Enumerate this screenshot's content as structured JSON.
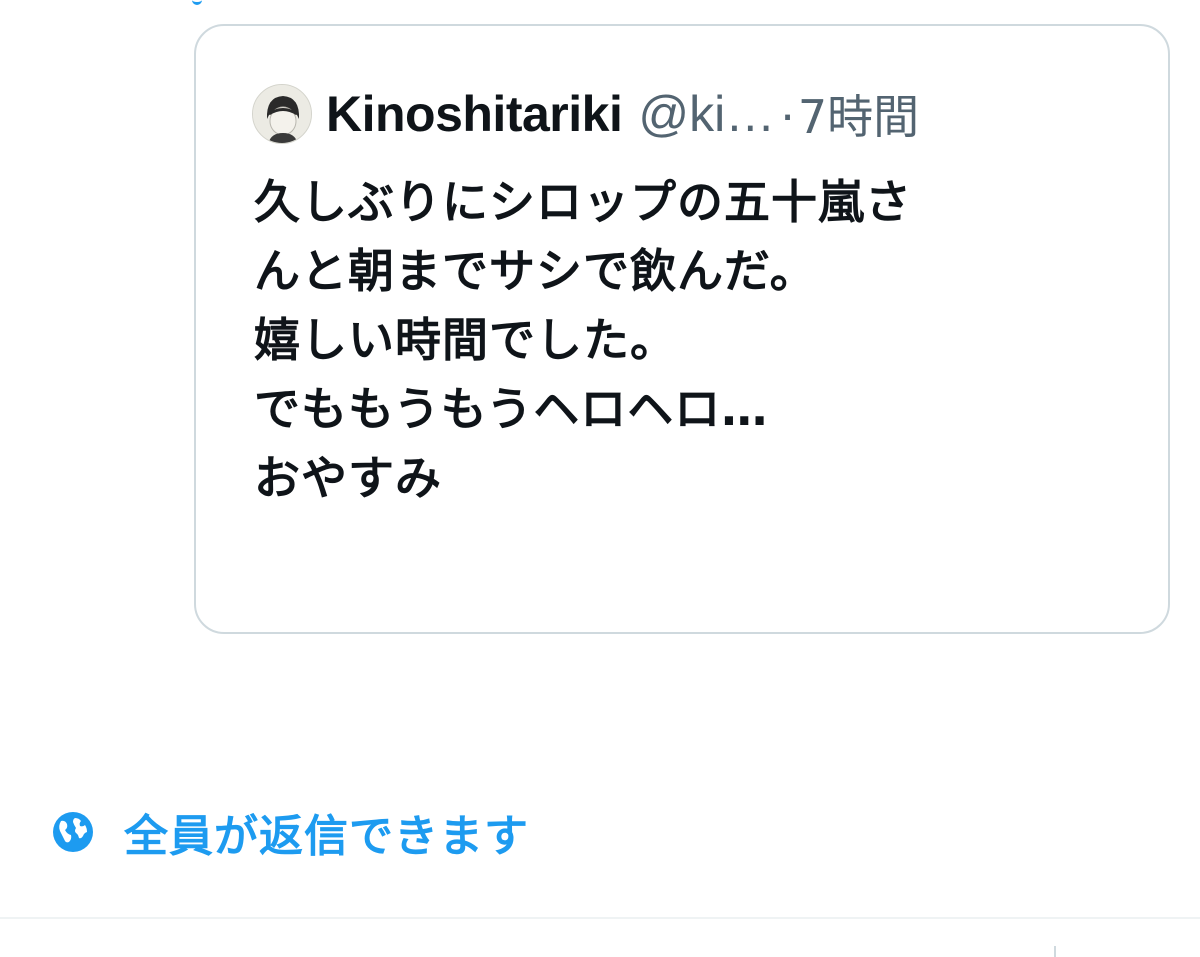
{
  "quoted_tweet": {
    "author": {
      "display_name": "Kinoshitariki",
      "handle": "@ki…",
      "avatar_icon": "avatar-icon"
    },
    "separator": "·",
    "time": "7時間",
    "lines": [
      "久しぶりにシロップの五十嵐さ",
      "んと朝までサシで飲んだ。",
      "嬉しい時間でした。",
      "でももうもうヘロヘロ…",
      "おやすみ"
    ]
  },
  "reply_setting": {
    "icon": "globe-icon",
    "label": "全員が返信できます"
  },
  "colors": {
    "accent": "#1d9bf0",
    "text_primary": "#0f1419",
    "text_secondary": "#536471",
    "border": "#cfd9de"
  }
}
